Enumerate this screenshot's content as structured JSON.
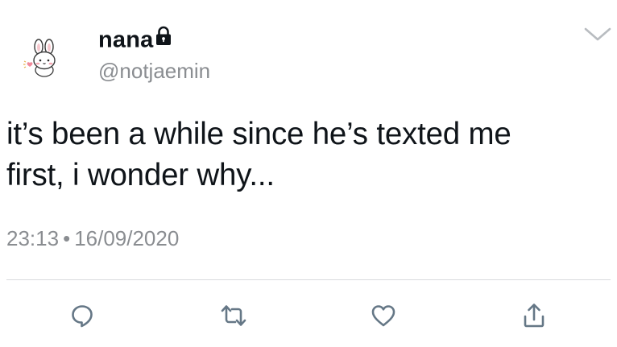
{
  "tweet": {
    "display_name": "nana",
    "handle": "@notjaemin",
    "text_line1": "it’s been a while since he’s texted me",
    "text_line2": "first, i wonder why...",
    "time": "23:13",
    "separator": "•",
    "date": "16/09/2020"
  },
  "icons": {
    "avatar": "bunny-avatar",
    "protected": "lock-icon",
    "more": "chevron-down-icon",
    "reply": "reply-icon",
    "retweet": "retweet-icon",
    "like": "heart-icon",
    "share": "share-icon"
  },
  "colors": {
    "text": "#0f1419",
    "secondary_text": "#8a8d91",
    "icon": "#657786",
    "divider": "#d9dadd",
    "chevron": "#b8bcc0"
  }
}
